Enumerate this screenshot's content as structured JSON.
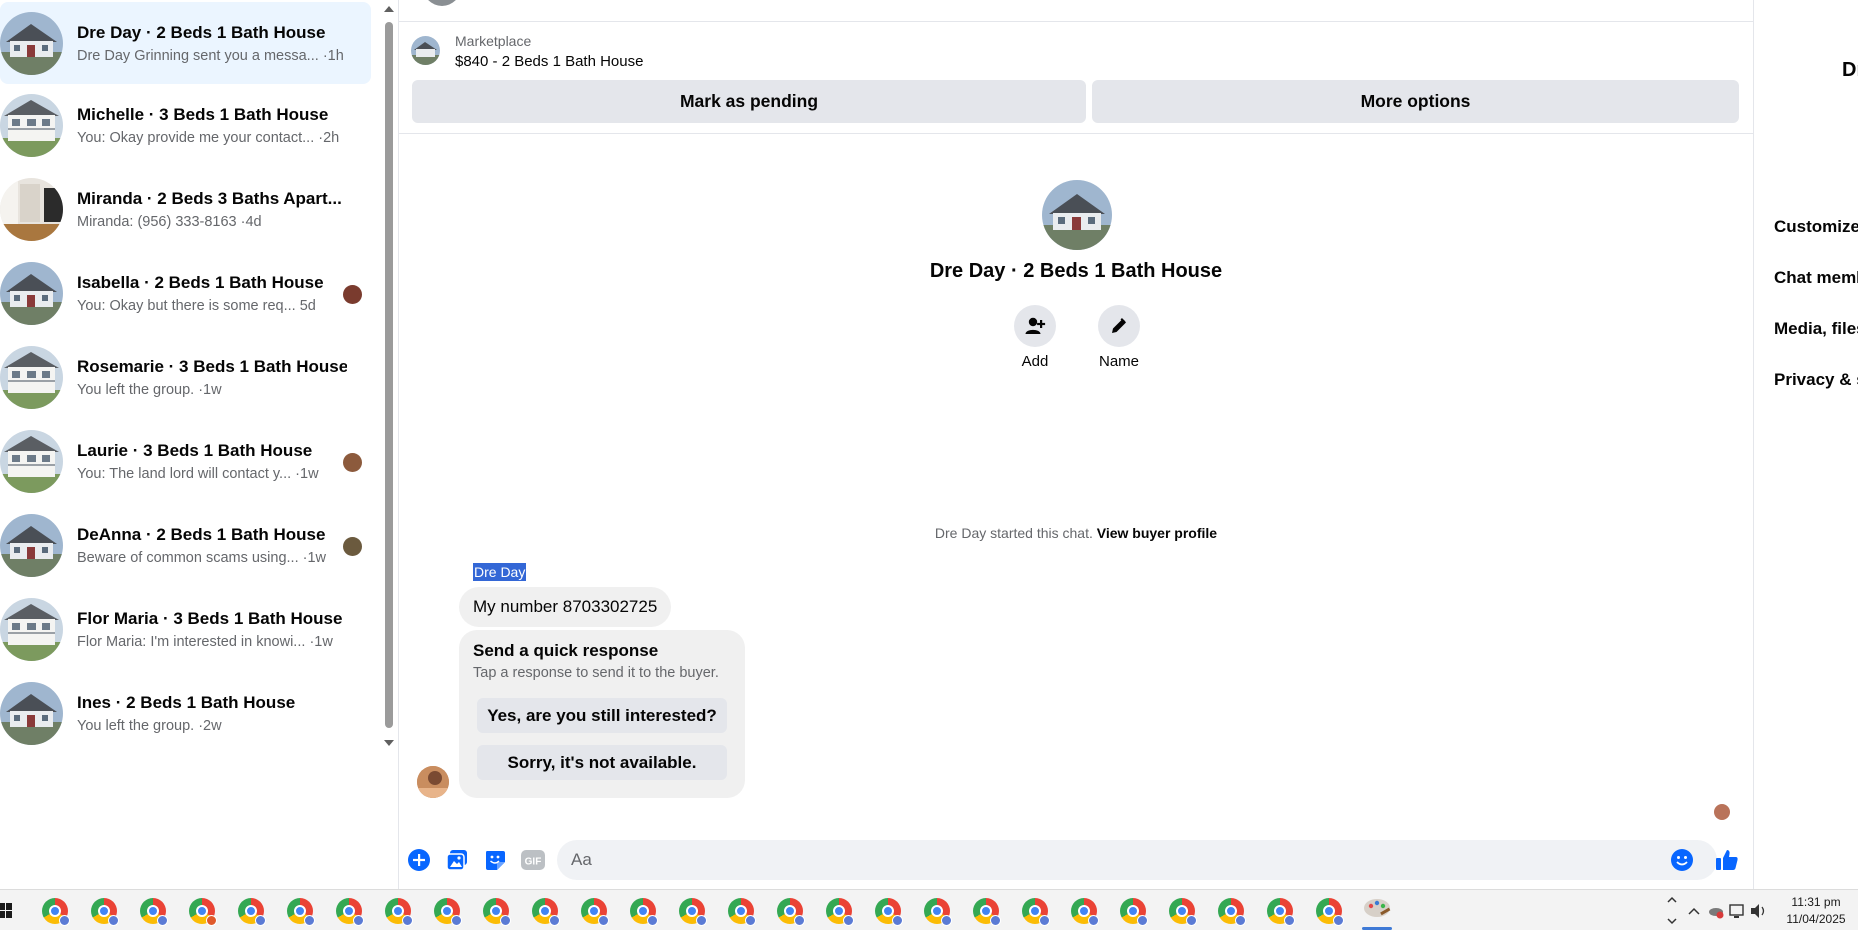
{
  "conversations": [
    {
      "name": "Dre Day · 2 Beds 1 Bath House",
      "preview": "Dre Day Grinning sent you a messa...",
      "time": "·1h",
      "active": true
    },
    {
      "name": "Michelle · 3 Beds 1 Bath House",
      "preview": "You: Okay provide me your contact...",
      "time": "·2h"
    },
    {
      "name": "Miranda · 2 Beds 3 Baths Apart...",
      "preview": "Miranda: (956) 333-8163",
      "time": "·4d"
    },
    {
      "name": "Isabella · 2 Beds 1 Bath House",
      "preview": "You: Okay but there is some req...",
      "time": "5d"
    },
    {
      "name": "Rosemarie · 3 Beds 1 Bath House",
      "preview": "You left the group.",
      "time": "·1w"
    },
    {
      "name": "Laurie · 3 Beds 1 Bath House",
      "preview": "You: The land lord will contact y...",
      "time": "·1w"
    },
    {
      "name": "DeAnna · 2 Beds 1 Bath House",
      "preview": "Beware of common scams using...",
      "time": "·1w"
    },
    {
      "name": "Flor Maria · 3 Beds 1 Bath House",
      "preview": "Flor Maria: I'm interested in knowi...",
      "time": "·1w"
    },
    {
      "name": "Ines · 2 Beds 1 Bath House",
      "preview": "You left the group.",
      "time": "·2w"
    }
  ],
  "marketplace": {
    "label": "Marketplace",
    "listing": "$840 - 2 Beds 1 Bath House",
    "mark_pending": "Mark as pending",
    "more_options": "More options"
  },
  "chat": {
    "title": "Dre Day · 2 Beds 1 Bath House",
    "add_label": "Add",
    "name_label": "Name",
    "started_text": "Dre Day started this chat.",
    "view_profile": "View buyer profile",
    "sender": "Dre Day",
    "message": "My number 8703302725",
    "quick_title": "Send a quick response",
    "quick_sub": "Tap a response to send it to the buyer.",
    "quick_1": "Yes, are you still interested?",
    "quick_2": "Sorry, it's not available."
  },
  "composer": {
    "placeholder": "Aa"
  },
  "right_panel": {
    "name": "Dr",
    "items": [
      "Customize",
      "Chat meml",
      "Media, files",
      "Privacy & s"
    ]
  },
  "taskbar": {
    "time": "11:31 pm",
    "date": "11/04/2025"
  },
  "colors": {
    "accent": "#0866ff",
    "active_row": "#ebf5ff",
    "button_gray": "#e4e6eb",
    "bubble": "#f0f0f0",
    "muted_text": "#65676b"
  }
}
